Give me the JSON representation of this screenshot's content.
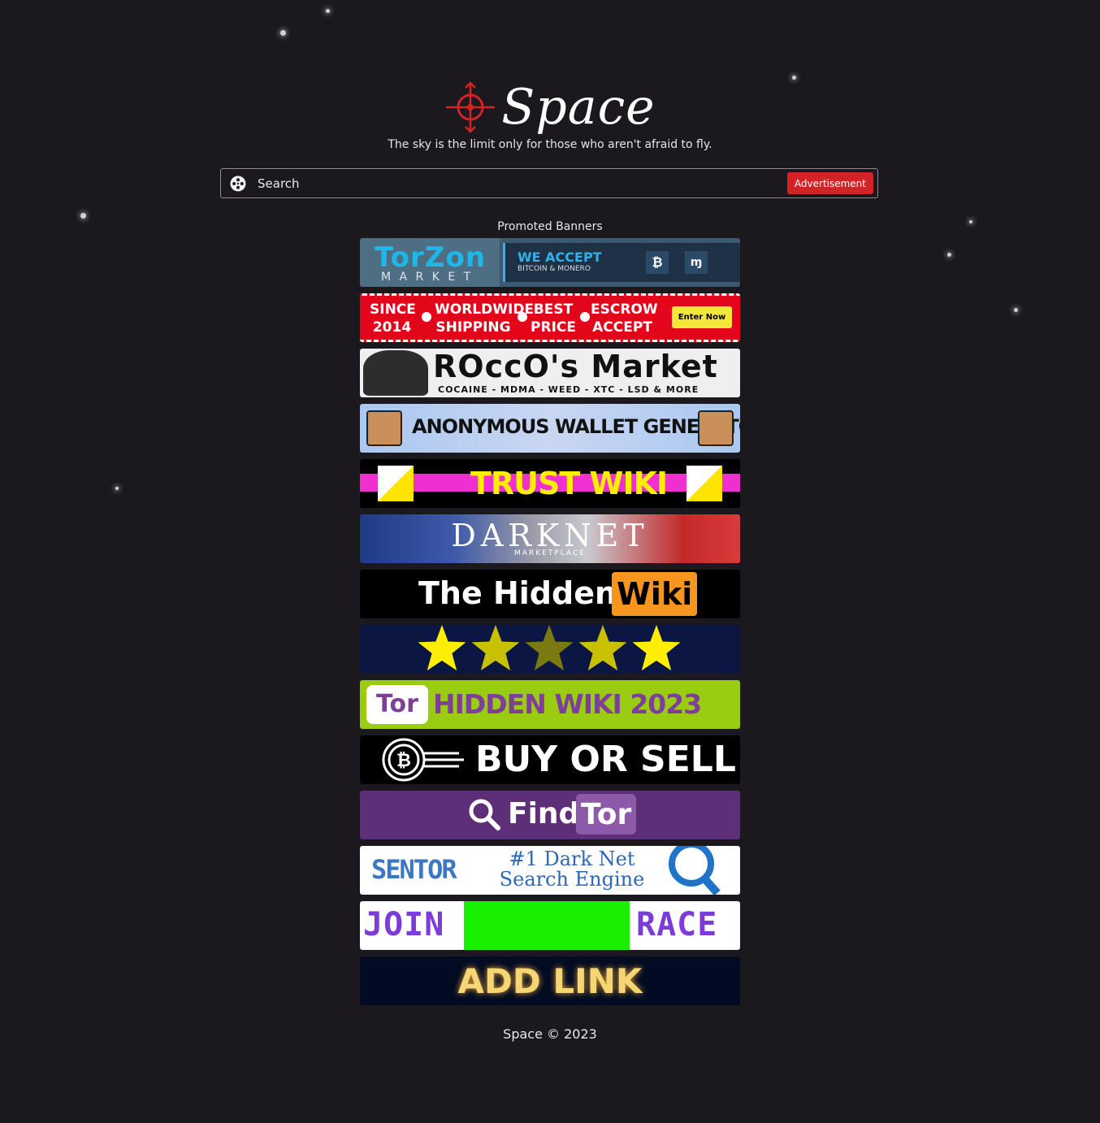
{
  "site": {
    "name": "Space",
    "tagline": "The sky is the limit only for those who aren't afraid to fly."
  },
  "search": {
    "placeholder": "Search",
    "ad_button": "Advertisement"
  },
  "promoted_title": "Promoted Banners",
  "banners": [
    {
      "id": "torzon",
      "main": "TorZon",
      "sub": "M A R K E T",
      "right_title": "WE ACCEPT",
      "right_sub": "BITCOIN & MONERO"
    },
    {
      "id": "since2014",
      "items": [
        "SINCE 2014",
        "WORLDWIDE SHIPPING",
        "BEST PRICE",
        "ESCROW ACCEPT"
      ],
      "button": "Enter Now"
    },
    {
      "id": "rocco",
      "main": "ROccO's Market",
      "sub": "COCAINE - MDMA - WEED - XTC - LSD & MORE"
    },
    {
      "id": "wallet",
      "main": "ANONYMOUS WALLET GENERATOR"
    },
    {
      "id": "trustwiki",
      "main": "TRUST WIKI"
    },
    {
      "id": "darknet",
      "main": "DARKNET",
      "sub": "MARKETPLACE"
    },
    {
      "id": "hiddenwiki",
      "main": "The Hidden",
      "badge": "Wiki"
    },
    {
      "id": "stars",
      "rating": 5
    },
    {
      "id": "tor2023",
      "logo": "Tor",
      "main": "HIDDEN WIKI 2023"
    },
    {
      "id": "buysell",
      "main": "BUY OR SELL"
    },
    {
      "id": "findtor",
      "main": "Find",
      "badge": "Tor"
    },
    {
      "id": "sentor",
      "logo": "SENTOR",
      "line1": "#1 Dark Net",
      "line2": "Search Engine"
    },
    {
      "id": "race",
      "left": "JOIN",
      "right": "RACE"
    },
    {
      "id": "addlink",
      "main": "ADD LINK"
    }
  ],
  "footer": "Space © 2023",
  "colors": {
    "background": "#1b191d",
    "accent": "#d32325"
  }
}
